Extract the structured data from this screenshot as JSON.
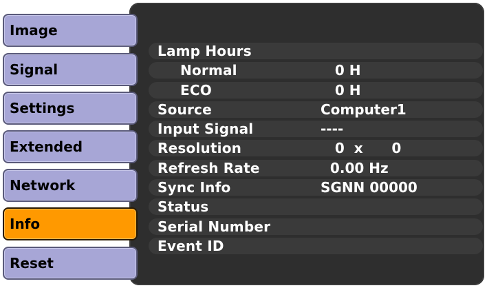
{
  "menu": {
    "items": [
      {
        "label": "Image",
        "active": false
      },
      {
        "label": "Signal",
        "active": false
      },
      {
        "label": "Settings",
        "active": false
      },
      {
        "label": "Extended",
        "active": false
      },
      {
        "label": "Network",
        "active": false
      },
      {
        "label": "Info",
        "active": true
      },
      {
        "label": "Reset",
        "active": false
      }
    ]
  },
  "info": {
    "rows": [
      {
        "label": "Lamp Hours",
        "value": ""
      },
      {
        "label": "Normal",
        "value": "   0 H"
      },
      {
        "label": "ECO",
        "value": "   0 H"
      },
      {
        "label": "Source",
        "value": "Computer1"
      },
      {
        "label": "Input Signal",
        "value": "----"
      },
      {
        "label": "Resolution",
        "value": "   0  x      0"
      },
      {
        "label": "Refresh Rate",
        "value": "  0.00 Hz"
      },
      {
        "label": "Sync Info",
        "value": "SGNN 00000"
      },
      {
        "label": "Status",
        "value": ""
      },
      {
        "label": "Serial Number",
        "value": ""
      },
      {
        "label": "Event ID",
        "value": ""
      }
    ]
  },
  "colors": {
    "tab_inactive": "#a7a6d6",
    "tab_active": "#ff9900",
    "panel_bg": "#2e2e2e",
    "text_light": "#ffffff"
  }
}
